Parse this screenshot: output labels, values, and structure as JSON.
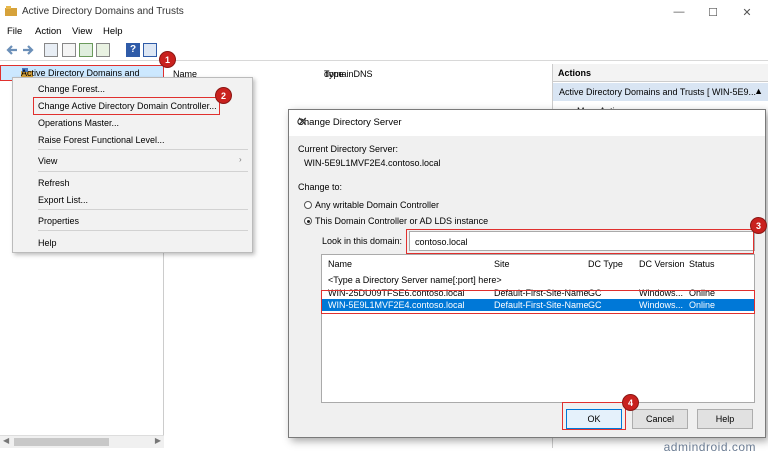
{
  "window": {
    "title": "Active Directory Domains and Trusts",
    "minimize": "—",
    "maximize": "☐",
    "close": "✕"
  },
  "menubar": {
    "items": [
      "File",
      "Action",
      "View",
      "Help"
    ]
  },
  "tree": {
    "root_label": "Active Directory Domains and Trusts"
  },
  "list": {
    "col_name": "Name",
    "col_type": "Type",
    "row_type": "domainDNS"
  },
  "actions": {
    "header": "Actions",
    "item": "Active Directory Domains and Trusts [ WIN-5E9...",
    "more": "More Actions"
  },
  "context_menu": {
    "items": [
      "Change Forest...",
      "Change Active Directory Domain Controller...",
      "Operations Master...",
      "Raise Forest Functional Level...",
      "View",
      "Refresh",
      "Export List...",
      "Properties",
      "Help"
    ]
  },
  "dialog": {
    "title": "Change Directory Server",
    "current_label": "Current Directory Server:",
    "current_value": "WIN-5E9L1MVF2E4.contoso.local",
    "change_to": "Change to:",
    "radio_any": "Any writable Domain Controller",
    "radio_this": "This Domain Controller or AD LDS instance",
    "look_in_label": "Look in this domain:",
    "domain_value": "contoso.local",
    "columns": [
      "Name",
      "Site",
      "DC Type",
      "DC Version",
      "Status"
    ],
    "type_hint": "<Type a Directory Server name[:port] here>",
    "rows": [
      {
        "name": "WIN-25DU09TFSE6.contoso.local",
        "site": "Default-First-Site-Name",
        "dc_type": "GC",
        "dc_version": "Windows...",
        "status": "Online"
      },
      {
        "name": "WIN-5E9L1MVF2E4.contoso.local",
        "site": "Default-First-Site-Name",
        "dc_type": "GC",
        "dc_version": "Windows...",
        "status": "Online"
      }
    ],
    "ok": "OK",
    "cancel": "Cancel",
    "help": "Help"
  },
  "badges": [
    "1",
    "2",
    "3",
    "4"
  ],
  "watermark": "admindroid.com",
  "colors": {
    "highlight_red": "#e0302e",
    "badge_red": "#c9211e",
    "selection_blue": "#0078d7"
  }
}
